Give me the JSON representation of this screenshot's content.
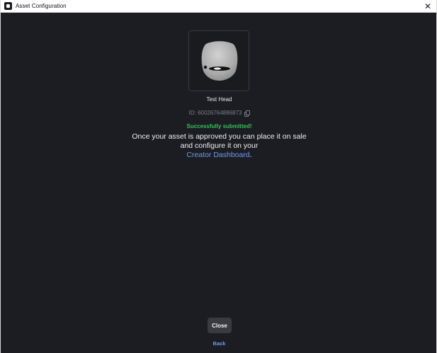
{
  "window": {
    "title": "Asset Configuration",
    "close_glyph": "✕"
  },
  "asset": {
    "name": "Test Head",
    "id_text": "ID: 60026764886873",
    "thumbnail_icon": "head-mesh-icon"
  },
  "status": {
    "success_text": "Successfully submitted!",
    "message_line1": "Once your asset is approved you can place it on sale",
    "message_line2": "and configure it on your",
    "link_text": "Creator Dashboard",
    "message_end": "."
  },
  "actions": {
    "close_label": "Close",
    "back_label": "Back"
  },
  "colors": {
    "background": "#1c1d22",
    "success": "#35c15a",
    "link": "#6e9bf5",
    "button": "#393b40"
  }
}
